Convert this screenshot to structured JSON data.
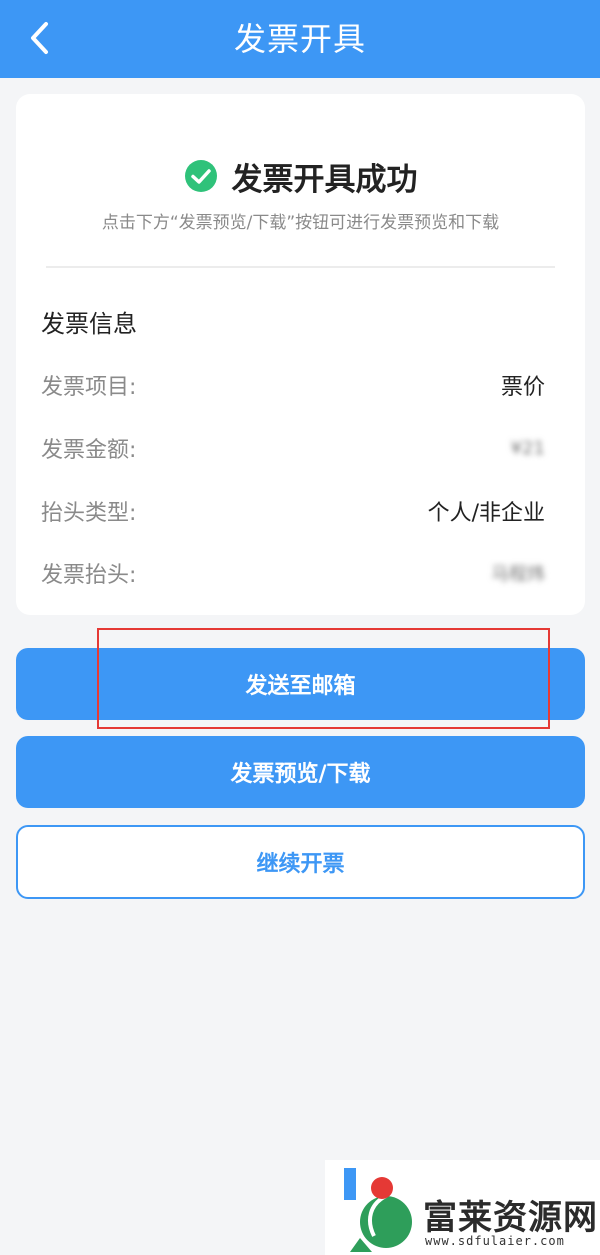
{
  "header": {
    "title": "发票开具"
  },
  "result": {
    "title": "发票开具成功",
    "hint": "点击下方“发票预览/下载”按钮可进行发票预览和下载"
  },
  "invoice_info": {
    "section_title": "发票信息",
    "rows": [
      {
        "label": "发票项目:",
        "value": "票价"
      },
      {
        "label": "发票金额:",
        "value": "¥21"
      },
      {
        "label": "抬头类型:",
        "value": "个人/非企业"
      },
      {
        "label": "发票抬头:",
        "value": "马程炜"
      }
    ]
  },
  "actions": {
    "send_email": "发送至邮箱",
    "preview_download": "发票预览/下载",
    "continue": "继续开票"
  },
  "watermark": {
    "brand": "富莱资源网",
    "url": "www.sdfulaier.com"
  },
  "colors": {
    "primary": "#3d97f5",
    "success": "#2fc27a",
    "highlight": "#e53935"
  }
}
